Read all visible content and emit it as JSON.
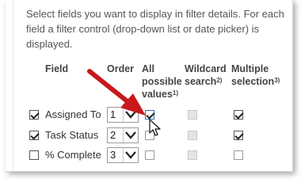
{
  "description": "Select fields you want to display in filter details. For each field a filter control (drop-down list or date picker) is displayed.",
  "headers": {
    "field": "Field",
    "order": "Order",
    "all_possible_values": "All possible values",
    "all_possible_values_note": "1)",
    "wildcard_search": "Wildcard search",
    "wildcard_search_note": "2)",
    "multiple_selection": "Multiple selection",
    "multiple_selection_note": "3)"
  },
  "rows": [
    {
      "field": "Assigned To",
      "order": "1",
      "enabled": true,
      "all_possible_values": true,
      "wildcard_search": false,
      "multiple_selection": true
    },
    {
      "field": "Task Status",
      "order": "2",
      "enabled": true,
      "all_possible_values": false,
      "wildcard_search": false,
      "multiple_selection": true
    },
    {
      "field": "% Complete",
      "order": "3",
      "enabled": false,
      "all_possible_values": false,
      "wildcard_search": false,
      "multiple_selection": false
    }
  ],
  "colors": {
    "annotation_arrow": "#c8191c",
    "text": "#555555",
    "checkbox_border": "#555555"
  },
  "annotation": "red-arrow-pointing-at-checkbox"
}
